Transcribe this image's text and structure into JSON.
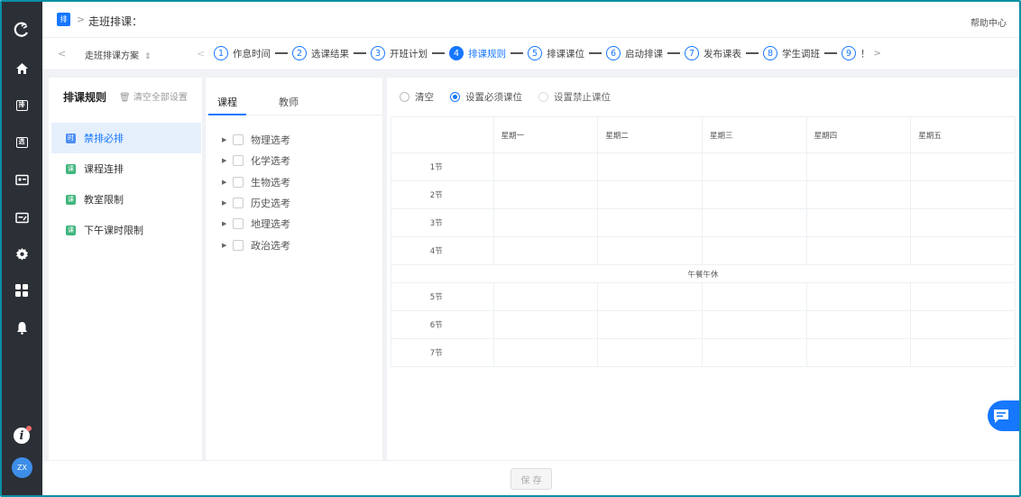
{
  "topbar": {
    "badge": "排",
    "separator": ">",
    "title": "走班排课：",
    "help": "帮助中心"
  },
  "rail": {
    "icons": [
      "logo-icon",
      "home-icon",
      "schedule-icon",
      "selection-icon",
      "classroom-icon",
      "exam-icon",
      "gear-icon",
      "apps-icon",
      "bell-icon"
    ],
    "schedule_box": "排",
    "selection_box": "选",
    "avatar": "ZX",
    "info": "i"
  },
  "stepbar": {
    "prev": "<",
    "plan_label": "走班排课方案",
    "plan_caret": "⇕",
    "prev2": "<",
    "more": ">",
    "steps": [
      {
        "num": "1",
        "label": "作息时间"
      },
      {
        "num": "2",
        "label": "选课结果"
      },
      {
        "num": "3",
        "label": "开班计划"
      },
      {
        "num": "4",
        "label": "排课规则"
      },
      {
        "num": "5",
        "label": "排课课位"
      },
      {
        "num": "6",
        "label": "启动排课"
      },
      {
        "num": "7",
        "label": "发布课表"
      },
      {
        "num": "8",
        "label": "学生调班"
      },
      {
        "num": "9",
        "label": "！"
      }
    ]
  },
  "left_panel": {
    "title": "排课规则",
    "clear_all": "清空全部设置",
    "items": [
      {
        "icon": "时",
        "label": "禁排必排",
        "color": "#4c8df6"
      },
      {
        "icon": "课",
        "label": "课程连排",
        "color": "#3fb57c"
      },
      {
        "icon": "课",
        "label": "教室限制",
        "color": "#3fb57c"
      },
      {
        "icon": "课",
        "label": "下午课时限制",
        "color": "#3fb57c"
      }
    ]
  },
  "mid_panel": {
    "tabs": [
      "课程",
      "教师"
    ],
    "courses": [
      "物理选考",
      "化学选考",
      "生物选考",
      "历史选考",
      "地理选考",
      "政治选考"
    ]
  },
  "right_panel": {
    "radios": [
      {
        "label": "清空",
        "state": "unchecked"
      },
      {
        "label": "设置必须课位",
        "state": "checked"
      },
      {
        "label": "设置禁止课位",
        "state": "disabled"
      }
    ],
    "weekdays": [
      "星期一",
      "星期二",
      "星期三",
      "星期四",
      "星期五"
    ],
    "periods_morning": [
      "1节",
      "2节",
      "3节",
      "4节"
    ],
    "lunch": "午餐午休",
    "periods_afternoon": [
      "5节",
      "6节",
      "7节"
    ]
  },
  "bottom": {
    "save": "保 存"
  },
  "colors": {
    "accent": "#1677ff",
    "rail": "#2b2f36",
    "frame": "#0a8fa6"
  }
}
